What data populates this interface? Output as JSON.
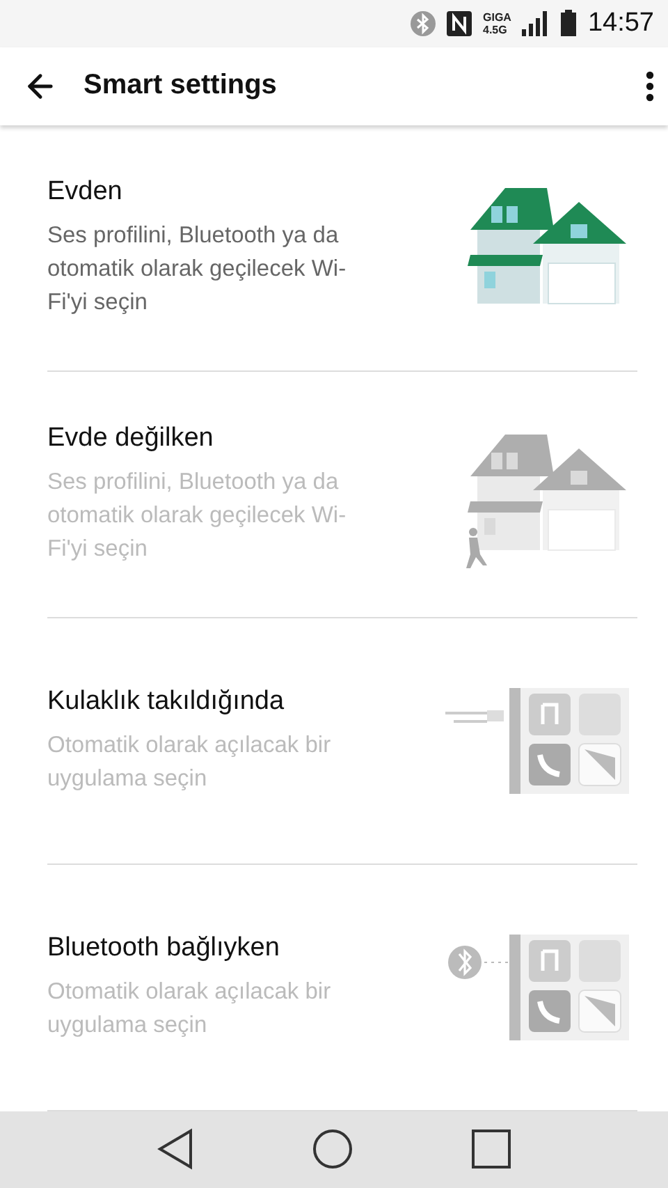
{
  "status_bar": {
    "network_top": "GIGA",
    "network_bottom": "4.5G",
    "time": "14:57"
  },
  "app_bar": {
    "title": "Smart settings"
  },
  "items": [
    {
      "title": "Evden",
      "description": "Ses profilini, Bluetooth ya da otomatik olarak geçilecek Wi-Fi'yi seçin",
      "active": true,
      "kind": "home"
    },
    {
      "title": "Evde değilken",
      "description": "Ses profilini, Bluetooth ya da otomatik olarak geçilecek Wi-Fi'yi seçin",
      "active": false,
      "kind": "away"
    },
    {
      "title": "Kulaklık takıldığında",
      "description": "Otomatik olarak açılacak bir uygulama seçin",
      "active": false,
      "kind": "headset"
    },
    {
      "title": "Bluetooth bağlıyken",
      "description": "Otomatik olarak açılacak bir uygulama seçin",
      "active": false,
      "kind": "bluetooth"
    }
  ]
}
